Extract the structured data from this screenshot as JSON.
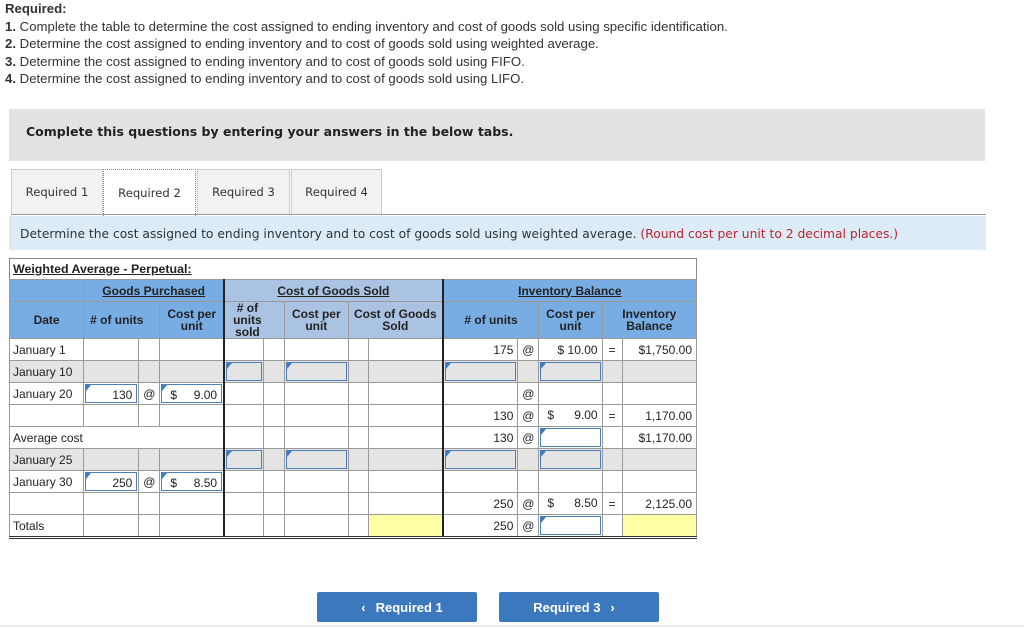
{
  "required": {
    "heading": "Required:",
    "items": [
      {
        "num": "1.",
        "text": " Complete the table to determine the cost assigned to ending inventory and cost of goods sold using specific identification."
      },
      {
        "num": "2.",
        "text": " Determine the cost assigned to ending inventory and to cost of goods sold using weighted average."
      },
      {
        "num": "3.",
        "text": " Determine the cost assigned to ending inventory and to cost of goods sold using FIFO."
      },
      {
        "num": "4.",
        "text": " Determine the cost assigned to ending inventory and to cost of goods sold using LIFO."
      }
    ]
  },
  "banner": "Complete this questions by entering your answers in the below tabs.",
  "tabs": [
    {
      "label": "Required 1"
    },
    {
      "label": "Required 2",
      "active": true
    },
    {
      "label": "Required 3"
    },
    {
      "label": "Required 4"
    }
  ],
  "instruction": {
    "text": "Determine the cost assigned to ending inventory and to cost of goods sold using weighted average.",
    "note": "(Round cost per unit to 2 decimal places.)",
    "note_color": "#c0242f"
  },
  "table": {
    "title": "Weighted Average - Perpetual:",
    "groups": {
      "purchased": "Goods Purchased",
      "cogs": "Cost of Goods Sold",
      "balance": "Inventory Balance"
    },
    "headers": {
      "date": "Date",
      "gp_units": "# of units",
      "gp_cost": "Cost per unit",
      "cogs_units": "# of units sold",
      "cogs_cost": "Cost per unit",
      "cogs_total": "Cost of Goods Sold",
      "ib_units": "# of units",
      "ib_cost": "Cost per unit",
      "ib_total": "Inventory Balance"
    },
    "at": "@",
    "eq": "=",
    "dollar": "$",
    "rows": {
      "jan1": {
        "date": "January 1",
        "ib_units": "175",
        "ib_cost": "$  10.00",
        "ib_total": "$1,750.00"
      },
      "jan10": {
        "date": "January 10"
      },
      "jan20": {
        "date": "January 20",
        "gp_units": "130",
        "gp_cost": "9.00"
      },
      "jan20b": {
        "ib_units": "130",
        "ib_cost": "9.00",
        "ib_total": "1,170.00"
      },
      "avg": {
        "date": "Average cost",
        "ib_units": "130",
        "ib_total": "$1,170.00"
      },
      "jan25": {
        "date": "January 25"
      },
      "jan30": {
        "date": "January 30",
        "gp_units": "250",
        "gp_cost": "8.50"
      },
      "jan30b": {
        "ib_units": "250",
        "ib_cost": "8.50",
        "ib_total": "2,125.00"
      },
      "totals": {
        "date": "Totals",
        "ib_units": "250"
      }
    }
  },
  "nav": {
    "prev": "Required 1",
    "next": "Required 3",
    "prev_icon": "‹",
    "next_icon": "›"
  },
  "colors": {
    "accent": "#3b78bd",
    "header_blue": "#78ade3",
    "header_gray_blue": "#aac3e2",
    "answer_yellow": "#ffffa6"
  }
}
